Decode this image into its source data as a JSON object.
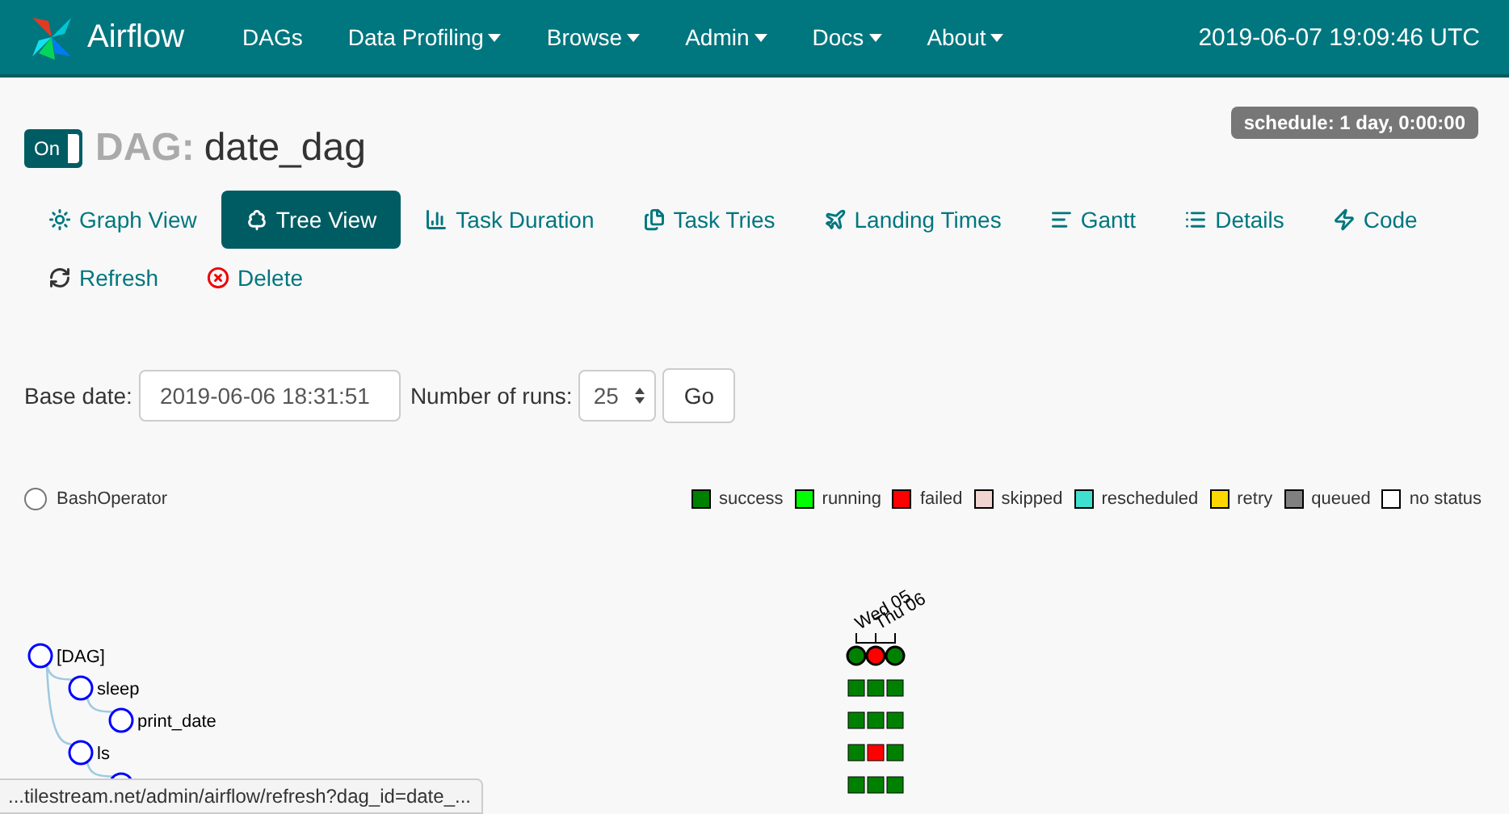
{
  "navbar": {
    "brand": "Airflow",
    "menu": [
      {
        "label": "DAGs",
        "dropdown": false
      },
      {
        "label": "Data Profiling",
        "dropdown": true
      },
      {
        "label": "Browse",
        "dropdown": true
      },
      {
        "label": "Admin",
        "dropdown": true
      },
      {
        "label": "Docs",
        "dropdown": true
      },
      {
        "label": "About",
        "dropdown": true
      }
    ],
    "clock": "2019-06-07 19:09:46 UTC"
  },
  "header": {
    "toggle": {
      "label": "On",
      "on": true
    },
    "prefix": "DAG:",
    "dag_id": "date_dag",
    "schedule": "schedule: 1 day, 0:00:00"
  },
  "views": [
    {
      "kind": "graph",
      "label": "Graph View",
      "selected": false
    },
    {
      "kind": "tree",
      "label": "Tree View",
      "selected": true
    },
    {
      "kind": "duration",
      "label": "Task Duration",
      "selected": false
    },
    {
      "kind": "tries",
      "label": "Task Tries",
      "selected": false
    },
    {
      "kind": "landing",
      "label": "Landing Times",
      "selected": false
    },
    {
      "kind": "gantt",
      "label": "Gantt",
      "selected": false
    },
    {
      "kind": "details",
      "label": "Details",
      "selected": false
    },
    {
      "kind": "code",
      "label": "Code",
      "selected": false
    }
  ],
  "actions": [
    {
      "kind": "refresh",
      "label": "Refresh"
    },
    {
      "kind": "delete",
      "label": "Delete"
    }
  ],
  "form": {
    "base_date_label": "Base date:",
    "base_date": "2019-06-06 18:31:51",
    "runs_label": "Number of runs:",
    "runs": "25",
    "go": "Go"
  },
  "operators": [
    {
      "label": "BashOperator"
    }
  ],
  "legend": [
    {
      "label": "success",
      "color": "#008000"
    },
    {
      "label": "running",
      "color": "#00ff00"
    },
    {
      "label": "failed",
      "color": "#ff0000"
    },
    {
      "label": "skipped",
      "color": "#f0d4cf"
    },
    {
      "label": "rescheduled",
      "color": "#40e0d0"
    },
    {
      "label": "retry",
      "color": "#ffd700"
    },
    {
      "label": "queued",
      "color": "#808080"
    },
    {
      "label": "no status",
      "color": "#ffffff"
    }
  ],
  "dates": [
    "Wed 05",
    "Thu 06"
  ],
  "tree": {
    "label": "[DAG]",
    "runs": [
      {
        "color": "#008000"
      },
      {
        "color": "#ff0000"
      },
      {
        "color": "#008000"
      }
    ],
    "children": [
      {
        "label": "sleep",
        "runs": [
          {
            "color": "#008000"
          },
          {
            "color": "#008000"
          },
          {
            "color": "#008000"
          }
        ],
        "children": [
          {
            "label": "print_date",
            "runs": [
              {
                "color": "#008000"
              },
              {
                "color": "#008000"
              },
              {
                "color": "#008000"
              }
            ]
          }
        ]
      },
      {
        "label": "ls",
        "runs": [
          {
            "color": "#008000"
          },
          {
            "color": "#ff0000"
          },
          {
            "color": "#008000"
          }
        ],
        "children": [
          {
            "runs": [
              {
                "color": "#008000"
              },
              {
                "color": "#008000"
              },
              {
                "color": "#008000"
              }
            ]
          }
        ]
      }
    ]
  },
  "status_bar": "...tilestream.net/admin/airflow/refresh?dag_id=date_..."
}
